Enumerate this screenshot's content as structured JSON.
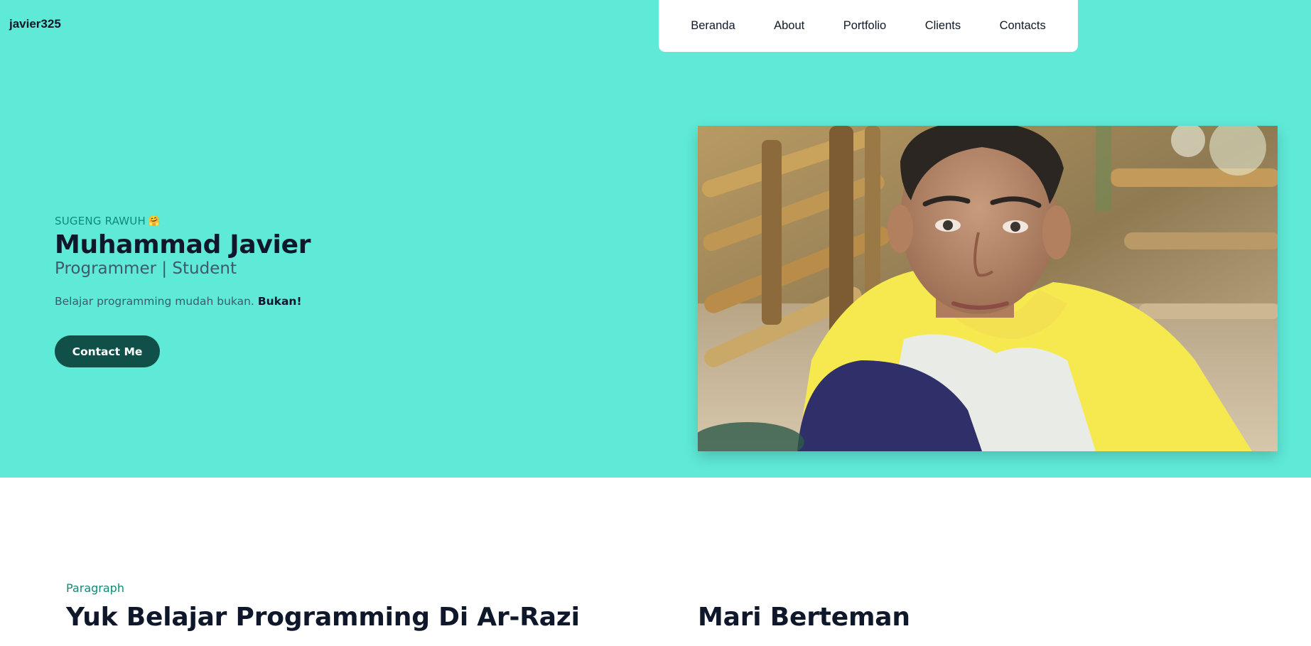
{
  "brand": "javier325",
  "nav": {
    "items": [
      "Beranda",
      "About",
      "Portfolio",
      "Clients",
      "Contacts"
    ]
  },
  "hero": {
    "greeting": "SUGENG RAWUH",
    "greeting_emoji": "🤗",
    "name": "Muhammad Javier",
    "role": "Programmer | Student",
    "tagline_prefix": "Belajar programming mudah bukan.",
    "tagline_emphasis": "Bukan!",
    "cta_label": "Contact Me",
    "background_color": "#5fe9d7",
    "button_color": "#115049"
  },
  "section2": {
    "eyebrow": "Paragraph",
    "heading_left": "Yuk Belajar Programming Di Ar-Razi",
    "heading_right": "Mari Berteman"
  }
}
